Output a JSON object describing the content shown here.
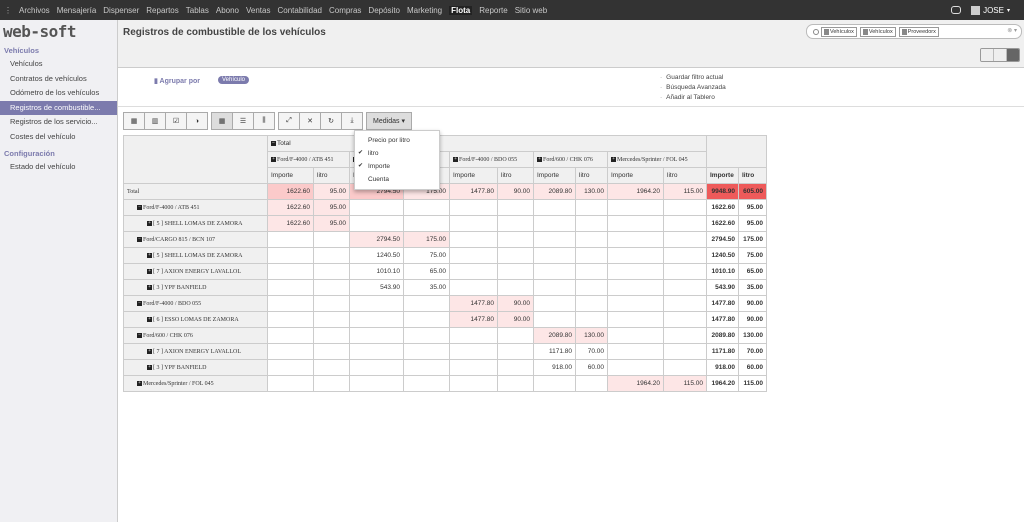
{
  "topbar": {
    "menu": [
      "Archivos",
      "Mensajería",
      "Dispenser",
      "Repartos",
      "Tablas",
      "Abono",
      "Ventas",
      "Contabilidad",
      "Compras",
      "Depósito",
      "Marketing",
      "Flota",
      "Reporte",
      "Sitio web"
    ],
    "active": "Flota",
    "user": "JOSE"
  },
  "sidebar": {
    "logo": "web-soft",
    "sections": [
      {
        "title": "Vehículos",
        "items": [
          "Vehículos",
          "Contratos de vehículos",
          "Odómetro de los vehículos",
          "Registros de combustible...",
          "Registros de los servicio...",
          "Costes del vehículo"
        ]
      },
      {
        "title": "Configuración",
        "items": [
          "Estado del vehículo"
        ]
      }
    ],
    "active": "Registros de combustible..."
  },
  "header": {
    "title": "Registros de combustible de los vehículos"
  },
  "search": {
    "facets": [
      "Vehículo",
      "Vehículo",
      "Proveedor"
    ]
  },
  "filters": {
    "group_label": "Agrupar por",
    "group_tag": "Vehículo",
    "options": [
      "Guardar filtro actual",
      "Búsqueda Avanzada",
      "Añadir al Tablero"
    ]
  },
  "toolbar": {
    "medidas": "Medidas"
  },
  "dropdown": [
    {
      "label": "Precio por litro",
      "checked": false
    },
    {
      "label": "litro",
      "checked": true
    },
    {
      "label": "Importe",
      "checked": true
    },
    {
      "label": "Cuenta",
      "checked": false
    }
  ],
  "colors": {
    "accent": "#7c7bad",
    "topbar": "#333333",
    "heat1": "#fde6e6",
    "heat2": "#fbcaca",
    "heatmax": "#ee5a5a"
  },
  "pivot": {
    "total_label": "Total",
    "col_groups": [
      "Ford/F-4000 / ATB 451",
      "Ford/CARGO 815 / BCN 107",
      "Ford/F-4000 / BDO 055",
      "Ford/600 / CHK 076",
      "Mercedes/Sprinter / FOL 045"
    ],
    "measure_labels": [
      "Importe",
      "litro"
    ],
    "rows": [
      {
        "label": "Total",
        "level": 0,
        "vals": [
          "1622.60",
          "95.00",
          "2794.50",
          "175.00",
          "1477.80",
          "90.00",
          "2089.80",
          "130.00",
          "1964.20",
          "115.00"
        ],
        "total": [
          "9948.90",
          "605.00"
        ],
        "heat": [
          2,
          1,
          2,
          1,
          1,
          1,
          1,
          1,
          1,
          1
        ]
      },
      {
        "label": "Ford/F-4000 / ATB 451",
        "level": 1,
        "icon": "−",
        "vals": [
          "1622.60",
          "95.00",
          "",
          "",
          "",
          "",
          "",
          "",
          "",
          ""
        ],
        "total": [
          "1622.60",
          "95.00"
        ],
        "heat": [
          1,
          1,
          0,
          0,
          0,
          0,
          0,
          0,
          0,
          0
        ]
      },
      {
        "label": "[ 5 ] SHELL LOMAS DE ZAMORA",
        "level": 2,
        "icon": "+",
        "vals": [
          "1622.60",
          "95.00",
          "",
          "",
          "",
          "",
          "",
          "",
          "",
          ""
        ],
        "total": [
          "1622.60",
          "95.00"
        ],
        "heat": [
          1,
          1,
          0,
          0,
          0,
          0,
          0,
          0,
          0,
          0
        ]
      },
      {
        "label": "Ford/CARGO 815 / BCN 107",
        "level": 1,
        "icon": "−",
        "vals": [
          "",
          "",
          "2794.50",
          "175.00",
          "",
          "",
          "",
          "",
          "",
          ""
        ],
        "total": [
          "2794.50",
          "175.00"
        ],
        "heat": [
          0,
          0,
          1,
          1,
          0,
          0,
          0,
          0,
          0,
          0
        ]
      },
      {
        "label": "[ 5 ] SHELL LOMAS DE ZAMORA",
        "level": 2,
        "icon": "+",
        "vals": [
          "",
          "",
          "1240.50",
          "75.00",
          "",
          "",
          "",
          "",
          "",
          ""
        ],
        "total": [
          "1240.50",
          "75.00"
        ],
        "heat": [
          0,
          0,
          0,
          0,
          0,
          0,
          0,
          0,
          0,
          0
        ]
      },
      {
        "label": "[ 7 ] AXION ENERGY LAVALLOL",
        "level": 2,
        "icon": "+",
        "vals": [
          "",
          "",
          "1010.10",
          "65.00",
          "",
          "",
          "",
          "",
          "",
          ""
        ],
        "total": [
          "1010.10",
          "65.00"
        ],
        "heat": [
          0,
          0,
          0,
          0,
          0,
          0,
          0,
          0,
          0,
          0
        ]
      },
      {
        "label": "[ 3 ] YPF BANFIELD",
        "level": 2,
        "icon": "+",
        "vals": [
          "",
          "",
          "543.90",
          "35.00",
          "",
          "",
          "",
          "",
          "",
          ""
        ],
        "total": [
          "543.90",
          "35.00"
        ],
        "heat": [
          0,
          0,
          0,
          0,
          0,
          0,
          0,
          0,
          0,
          0
        ]
      },
      {
        "label": "Ford/F-4000 / BDO 055",
        "level": 1,
        "icon": "−",
        "vals": [
          "",
          "",
          "",
          "",
          "1477.80",
          "90.00",
          "",
          "",
          "",
          ""
        ],
        "total": [
          "1477.80",
          "90.00"
        ],
        "heat": [
          0,
          0,
          0,
          0,
          1,
          1,
          0,
          0,
          0,
          0
        ]
      },
      {
        "label": "[ 6 ] ESSO LOMAS DE ZAMORA",
        "level": 2,
        "icon": "+",
        "vals": [
          "",
          "",
          "",
          "",
          "1477.80",
          "90.00",
          "",
          "",
          "",
          ""
        ],
        "total": [
          "1477.80",
          "90.00"
        ],
        "heat": [
          0,
          0,
          0,
          0,
          1,
          1,
          0,
          0,
          0,
          0
        ]
      },
      {
        "label": "Ford/600 / CHK 076",
        "level": 1,
        "icon": "−",
        "vals": [
          "",
          "",
          "",
          "",
          "",
          "",
          "2089.80",
          "130.00",
          "",
          ""
        ],
        "total": [
          "2089.80",
          "130.00"
        ],
        "heat": [
          0,
          0,
          0,
          0,
          0,
          0,
          1,
          1,
          0,
          0
        ]
      },
      {
        "label": "[ 7 ] AXION ENERGY LAVALLOL",
        "level": 2,
        "icon": "+",
        "vals": [
          "",
          "",
          "",
          "",
          "",
          "",
          "1171.80",
          "70.00",
          "",
          ""
        ],
        "total": [
          "1171.80",
          "70.00"
        ],
        "heat": [
          0,
          0,
          0,
          0,
          0,
          0,
          0,
          0,
          0,
          0
        ]
      },
      {
        "label": "[ 3 ] YPF BANFIELD",
        "level": 2,
        "icon": "+",
        "vals": [
          "",
          "",
          "",
          "",
          "",
          "",
          "918.00",
          "60.00",
          "",
          ""
        ],
        "total": [
          "918.00",
          "60.00"
        ],
        "heat": [
          0,
          0,
          0,
          0,
          0,
          0,
          0,
          0,
          0,
          0
        ]
      },
      {
        "label": "Mercedes/Sprinter / FOL 045",
        "level": 1,
        "icon": "+",
        "vals": [
          "",
          "",
          "",
          "",
          "",
          "",
          "",
          "",
          "1964.20",
          "115.00"
        ],
        "total": [
          "1964.20",
          "115.00"
        ],
        "heat": [
          0,
          0,
          0,
          0,
          0,
          0,
          0,
          0,
          1,
          1
        ]
      }
    ]
  }
}
